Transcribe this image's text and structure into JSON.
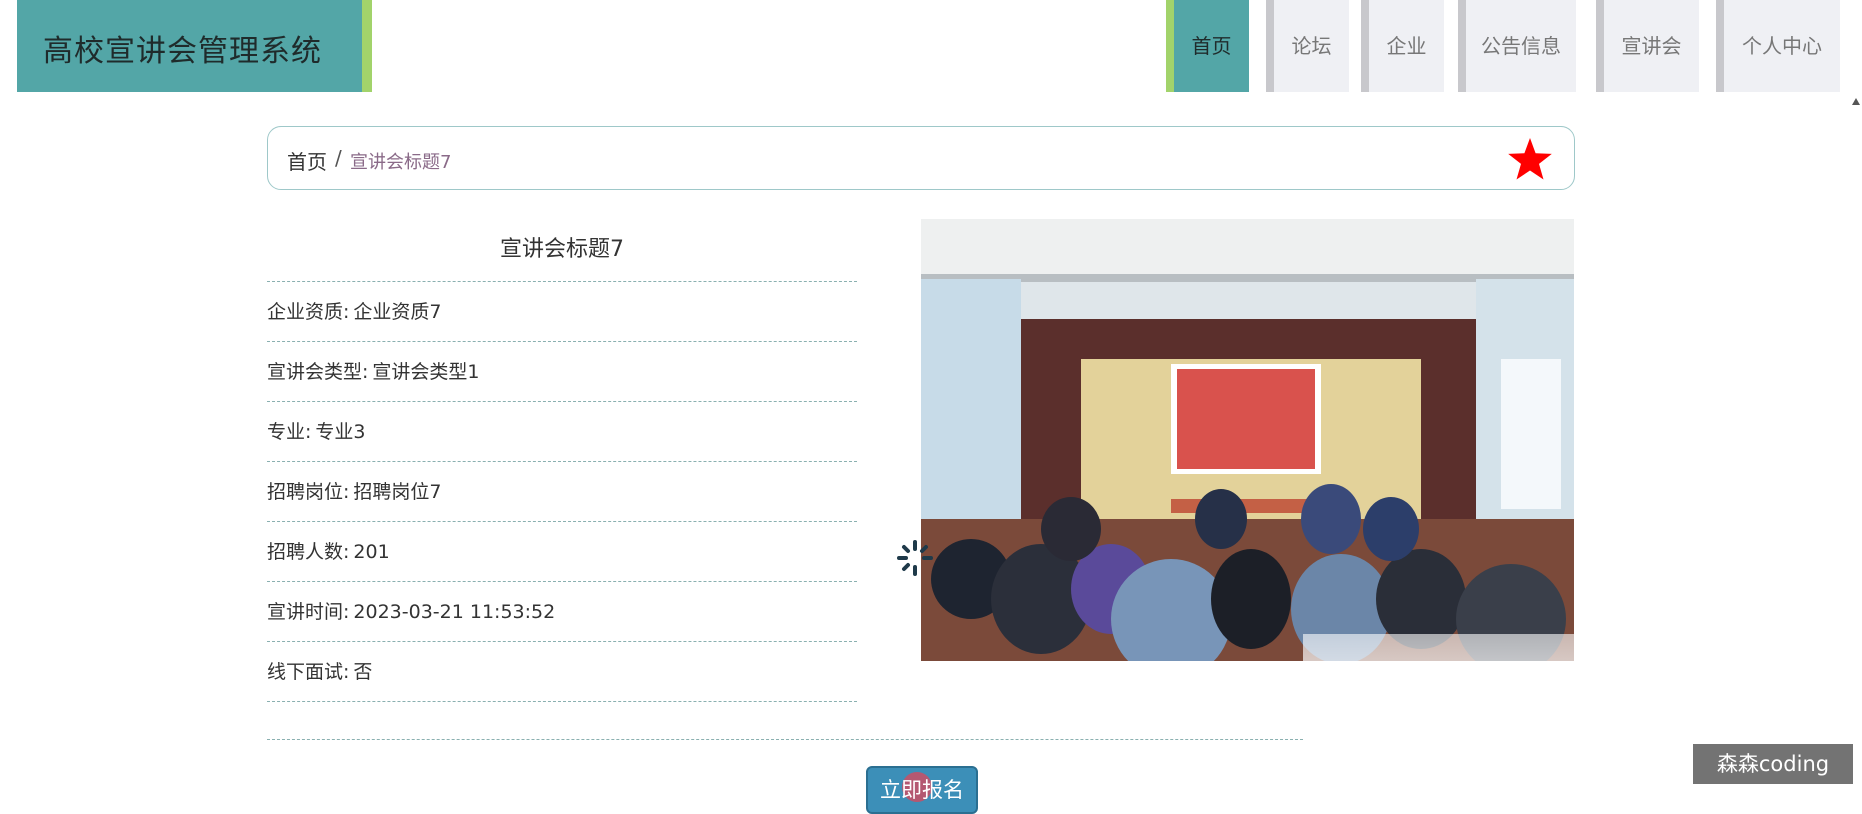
{
  "app": {
    "title": "高校宣讲会管理系统"
  },
  "nav": {
    "items": [
      {
        "label": "首页",
        "active": true
      },
      {
        "label": "论坛",
        "active": false
      },
      {
        "label": "企业",
        "active": false
      },
      {
        "label": "公告信息",
        "active": false
      },
      {
        "label": "宣讲会",
        "active": false
      },
      {
        "label": "个人中心",
        "active": false
      }
    ]
  },
  "breadcrumb": {
    "home": "首页",
    "separator": "/",
    "current": "宣讲会标题7"
  },
  "detail": {
    "title": "宣讲会标题7",
    "rows": [
      {
        "label": "企业资质:",
        "value": "企业资质7"
      },
      {
        "label": "宣讲会类型:",
        "value": "宣讲会类型1"
      },
      {
        "label": "专业:",
        "value": "专业3"
      },
      {
        "label": "招聘岗位:",
        "value": "招聘岗位7"
      },
      {
        "label": "招聘人数:",
        "value": "201"
      },
      {
        "label": "宣讲时间:",
        "value": "2023-03-21 11:53:52"
      },
      {
        "label": "线下面试:",
        "value": "否"
      }
    ]
  },
  "actions": {
    "signup_label": "立即报名"
  },
  "icons": {
    "favorite": "star-icon",
    "loading": "spinner-icon"
  },
  "colors": {
    "brand": "#53a6a7",
    "accent": "#a2d36b",
    "star": "#ff0000",
    "button": "#3c8fb8"
  },
  "watermark": "森森coding"
}
